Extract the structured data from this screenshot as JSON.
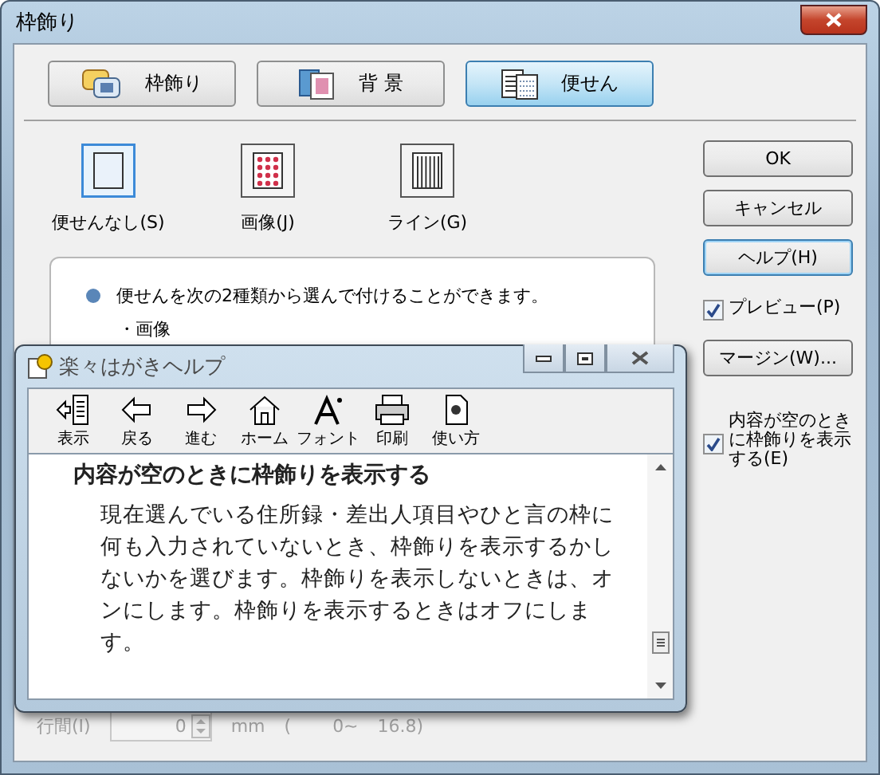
{
  "window": {
    "title": "枠飾り"
  },
  "tabs": [
    {
      "label": "枠飾り",
      "kind": "frame",
      "selected": false
    },
    {
      "label": "背 景",
      "kind": "background",
      "selected": false
    },
    {
      "label": "便せん",
      "kind": "letter",
      "selected": true
    }
  ],
  "styles": [
    {
      "label": "便せんなし(S)",
      "kind": "none",
      "selected": true
    },
    {
      "label": "画像(J)",
      "kind": "image",
      "selected": false
    },
    {
      "label": "ライン(G)",
      "kind": "line",
      "selected": false
    }
  ],
  "info": {
    "bullet": "便せんを次の2種類から選んで付けることができます。",
    "item": "・画像"
  },
  "line_spacing": {
    "label": "行間(I)",
    "value": "0",
    "unit": "mm",
    "range_open": "(",
    "range_min": "0~",
    "range_max": "16.8)",
    "disabled": true
  },
  "buttons": [
    {
      "label": "OK",
      "focused": false
    },
    {
      "label": "キャンセル",
      "focused": false
    },
    {
      "label": "ヘルプ(H)",
      "focused": true
    }
  ],
  "preview": {
    "label": "プレビュー(P)",
    "checked": true
  },
  "margin_button": "マージン(W)...",
  "empty_frame": {
    "label": "内容が空のときに枠飾りを表示する(E)",
    "checked": true
  },
  "help_window": {
    "title": "楽々はがきヘルプ",
    "toolbar": [
      {
        "label": "表示",
        "kind": "show"
      },
      {
        "label": "戻る",
        "kind": "back"
      },
      {
        "label": "進む",
        "kind": "forward"
      },
      {
        "label": "ホーム",
        "kind": "home"
      },
      {
        "label": "フォント",
        "kind": "font"
      },
      {
        "label": "印刷",
        "kind": "print"
      },
      {
        "label": "使い方",
        "kind": "usage"
      }
    ],
    "heading": "内容が空のときに枠飾りを表示する",
    "body": "現在選んでいる住所録・差出人項目やひと言の枠に何も入力されていないとき、枠飾りを表示するかしないかを選びます。枠飾りを表示しないときは、オンにします。枠飾りを表示するときはオフにします。"
  }
}
